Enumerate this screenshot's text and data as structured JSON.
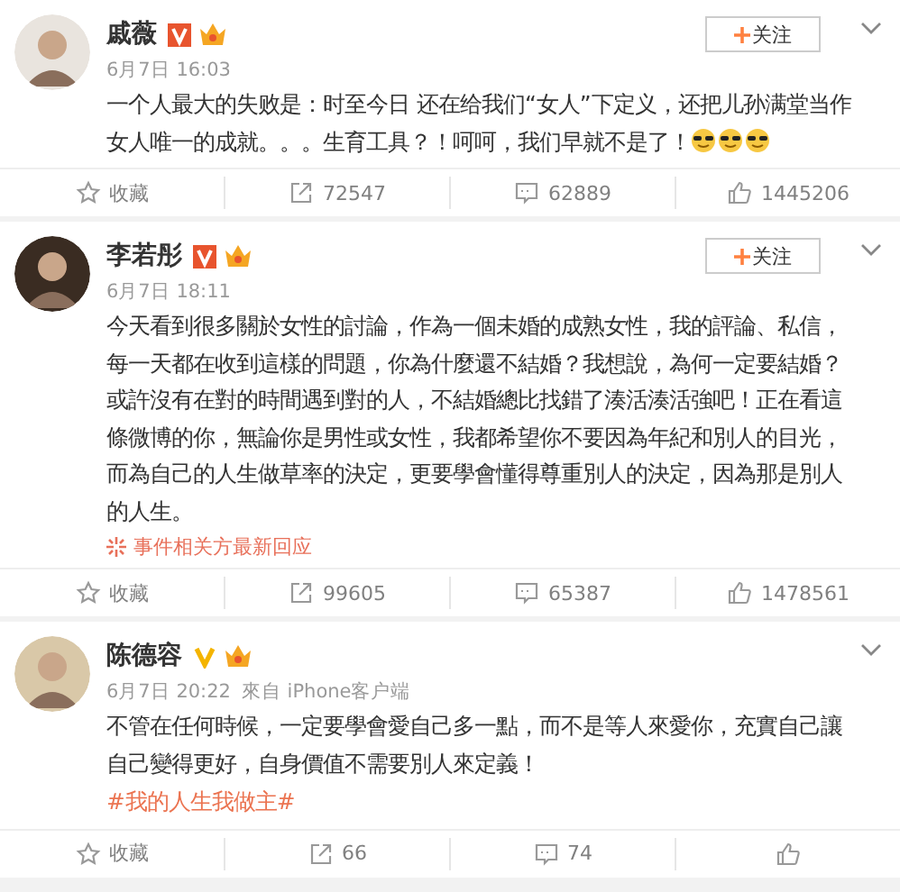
{
  "posts": [
    {
      "name": "戚薇",
      "verified": {
        "kind": "boxed"
      },
      "follow_button": {
        "label": "关注"
      },
      "time": "6月7日 16:03",
      "text": "一个人最大的失败是：时至今日 还在给我们“女人”下定义，还把儿孙满堂当作女人唯一的成就。。。生育工具？！呵呵，我们早就不是了！",
      "emojis": [
        {
          "kind": "sunglasses"
        },
        {
          "kind": "sunglasses"
        },
        {
          "kind": "sunglasses"
        }
      ],
      "actions": [
        {
          "kind": "favorite",
          "label": "收藏"
        },
        {
          "kind": "repost",
          "label": "72547"
        },
        {
          "kind": "comment",
          "label": "62889"
        },
        {
          "kind": "like",
          "label": "1445206"
        }
      ]
    },
    {
      "name": "李若彤",
      "verified": {
        "kind": "boxed"
      },
      "follow_button": {
        "label": "关注"
      },
      "time": "6月7日 18:11",
      "text": "今天看到很多關於女性的討論，作為一個未婚的成熟女性，我的評論、私信，每一天都在收到這樣的問題，你為什麼還不結婚？我想說，為何一定要結婚？或許沒有在對的時間遇到對的人，不結婚總比找錯了湊活湊活強吧！正在看這條微博的你，無論你是男性或女性，我都希望你不要因為年紀和別人的目光，而為自己的人生做草率的決定，更要學會懂得尊重別人的決定，因為那是別人的人生。",
      "related_link": "事件相关方最新回应",
      "actions": [
        {
          "kind": "favorite",
          "label": "收藏"
        },
        {
          "kind": "repost",
          "label": "99605"
        },
        {
          "kind": "comment",
          "label": "65387"
        },
        {
          "kind": "like",
          "label": "1478561"
        }
      ]
    },
    {
      "name": "陈德容",
      "verified": {
        "kind": "plain"
      },
      "time": "6月7日 20:22",
      "source": "來自 iPhone客户端",
      "text": "不管在任何時候，一定要學會愛自己多一點，而不是等人來愛你，充實自己讓自己變得更好，自身價值不需要別人來定義！",
      "hashtag": "#我的人生我做主#",
      "actions": [
        {
          "kind": "favorite",
          "label": "收藏"
        },
        {
          "kind": "repost",
          "label": "66"
        },
        {
          "kind": "comment",
          "label": "74"
        },
        {
          "kind": "like"
        }
      ]
    }
  ]
}
